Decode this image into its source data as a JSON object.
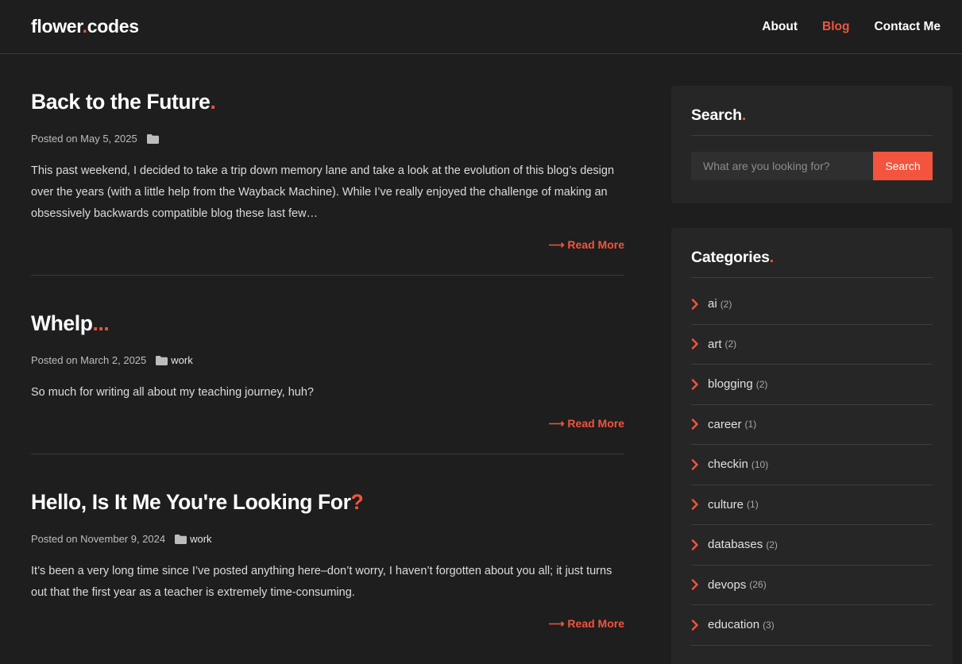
{
  "site": {
    "logo_pre": "flower",
    "logo_dot": ".",
    "logo_post": "codes",
    "accent": "#f2543d"
  },
  "nav": [
    {
      "label": "About",
      "active": false
    },
    {
      "label": "Blog",
      "active": true
    },
    {
      "label": "Contact Me",
      "active": false
    }
  ],
  "posts": [
    {
      "title": "Back to the Future",
      "title_suffix": ".",
      "meta_prefix": "Posted on May 5, 2025",
      "category": "",
      "excerpt": "This past weekend, I decided to take a trip down memory lane and take a look at the evolution of this blog’s design over the years (with a little help from the Wayback Machine). While I’ve really enjoyed the challenge of making an obsessively backwards compatible blog these last few…",
      "read_more": "Read More"
    },
    {
      "title": "Whelp",
      "title_suffix": "...",
      "meta_prefix": "Posted on March 2, 2025",
      "category": "work",
      "excerpt": "So much for writing all about my teaching journey, huh?",
      "read_more": "Read More"
    },
    {
      "title": "Hello, Is It Me You're Looking For",
      "title_suffix": "?",
      "meta_prefix": "Posted on November 9, 2024",
      "category": "work",
      "excerpt": "It’s been a very long time since I’ve posted anything here–don’t worry, I haven’t forgotten about you all; it just turns out that the first year as a teacher is extremely time-consuming.",
      "read_more": "Read More"
    }
  ],
  "sidebar": {
    "search": {
      "title": "Search",
      "title_dot": ".",
      "placeholder": "What are you looking for?",
      "button": "Search"
    },
    "categories": {
      "title": "Categories",
      "title_dot": ".",
      "items": [
        {
          "name": "ai",
          "count": "(2)"
        },
        {
          "name": "art",
          "count": "(2)"
        },
        {
          "name": "blogging",
          "count": "(2)"
        },
        {
          "name": "career",
          "count": "(1)"
        },
        {
          "name": "checkin",
          "count": "(10)"
        },
        {
          "name": "culture",
          "count": "(1)"
        },
        {
          "name": "databases",
          "count": "(2)"
        },
        {
          "name": "devops",
          "count": "(26)"
        },
        {
          "name": "education",
          "count": "(3)"
        }
      ]
    }
  }
}
